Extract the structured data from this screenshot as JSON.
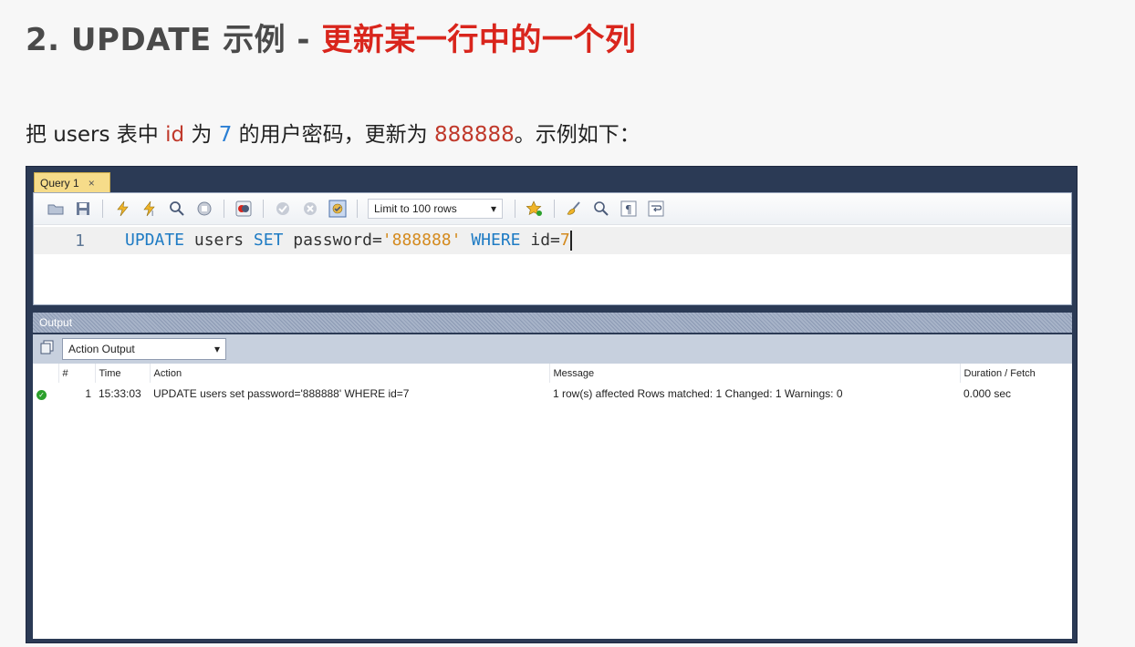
{
  "slide": {
    "title_prefix": "2. UPDATE 示例 - ",
    "title_highlight": "更新某一行中的一个列",
    "desc_1": "把 users 表中 ",
    "desc_id": "id",
    "desc_2": " 为 ",
    "desc_num": "7",
    "desc_3": " 的用户密码，更新为 ",
    "desc_val": "888888",
    "desc_4": "。示例如下："
  },
  "editor": {
    "tab_label": "Query 1",
    "tab_close": "×",
    "limit_select": "Limit to 100 rows",
    "line_number": "1",
    "code": {
      "kw_update": "UPDATE",
      "table": " users ",
      "kw_set": "SET",
      "assign": " password=",
      "value": "'888888'",
      "kw_where": " WHERE",
      "cond": " id=",
      "cond_val": "7"
    }
  },
  "output": {
    "header": "Output",
    "select": "Action Output",
    "columns": [
      "",
      "#",
      "Time",
      "Action",
      "Message",
      "Duration / Fetch"
    ],
    "rows": [
      {
        "status": "success",
        "index": "1",
        "time": "15:33:03",
        "action": "UPDATE users set password='888888' WHERE id=7",
        "message": "1 row(s) affected Rows matched: 1  Changed: 1  Warnings: 0",
        "duration": "0.000 sec"
      }
    ]
  },
  "colors": {
    "title_highlight": "#d9251c",
    "keyword": "#1e7bc4",
    "string": "#d48a1e",
    "window_bg": "#2b3a55",
    "tab_bg": "#f6dc8a"
  }
}
